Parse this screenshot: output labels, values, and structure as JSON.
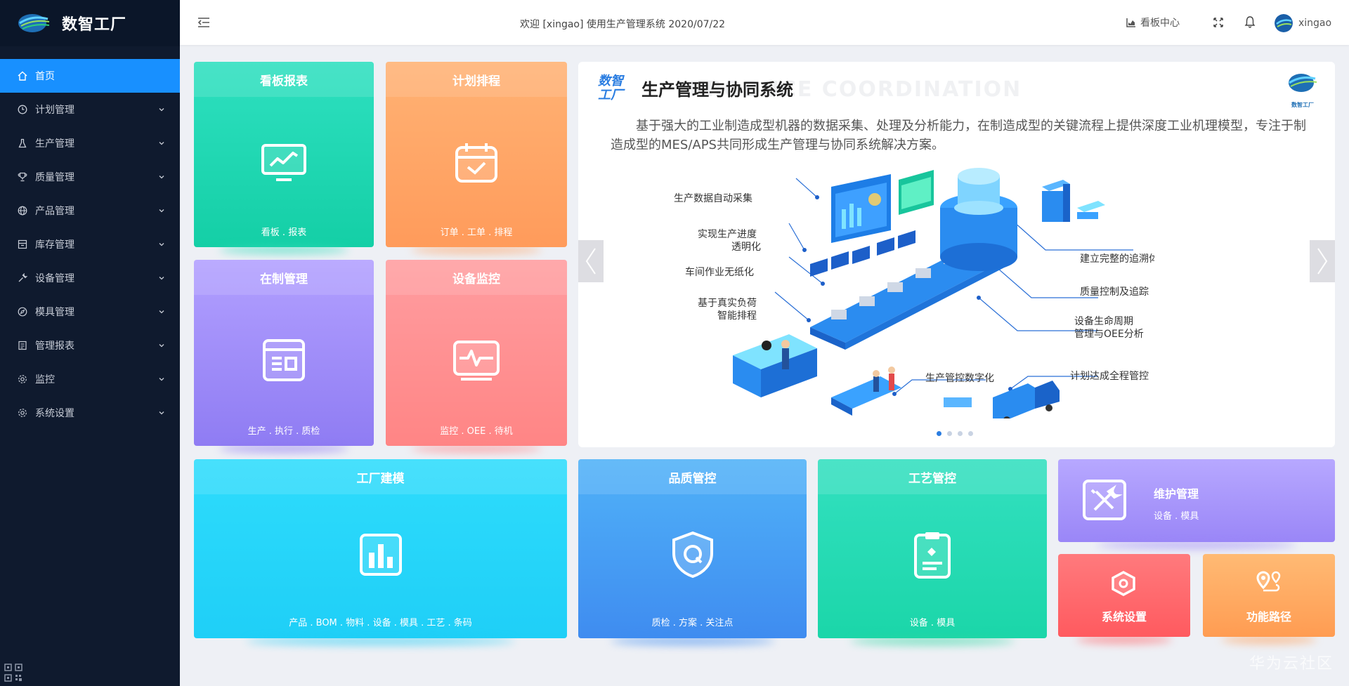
{
  "app": {
    "name": "数智工厂"
  },
  "sidebar": {
    "items": [
      {
        "label": "首页",
        "icon": "home-icon",
        "active": true
      },
      {
        "label": "计划管理",
        "icon": "clock-icon"
      },
      {
        "label": "生产管理",
        "icon": "flask-icon"
      },
      {
        "label": "质量管理",
        "icon": "trophy-icon"
      },
      {
        "label": "产品管理",
        "icon": "globe-icon"
      },
      {
        "label": "库存管理",
        "icon": "warehouse-icon"
      },
      {
        "label": "设备管理",
        "icon": "wrench-icon"
      },
      {
        "label": "模具管理",
        "icon": "compass-icon"
      },
      {
        "label": "管理报表",
        "icon": "report-icon"
      },
      {
        "label": "监控",
        "icon": "gear-icon"
      },
      {
        "label": "系统设置",
        "icon": "gear-icon"
      }
    ]
  },
  "header": {
    "welcome": "欢迎 [xingao] 使用生产管理系统 2020/07/22",
    "kanban_center": "看板中心",
    "username": "xingao"
  },
  "tiles": {
    "kanban": {
      "title": "看板报表",
      "sub": "看板 . 报表"
    },
    "plan": {
      "title": "计划排程",
      "sub": "订单 . 工单 . 排程"
    },
    "wip": {
      "title": "在制管理",
      "sub": "生产 . 执行 . 质检"
    },
    "monitor": {
      "title": "设备监控",
      "sub": "监控 . OEE . 待机"
    },
    "factory": {
      "title": "工厂建模",
      "sub": "产品 . BOM . 物料 . 设备 . 模具 . 工艺 . 条码"
    },
    "quality": {
      "title": "品质管控",
      "sub": "质检 . 方案 . 关注点"
    },
    "process": {
      "title": "工艺管控",
      "sub": "设备 . 模具"
    },
    "maintenance": {
      "title": "维护管理",
      "sub": "设备 . 模具"
    },
    "settings": {
      "title": "系统设置"
    },
    "route": {
      "title": "功能路径"
    }
  },
  "banner": {
    "brand_top": "数智",
    "brand_bottom": "工厂",
    "title": "生产管理与协同系统",
    "title_en": "PRODUCE COORDINATION",
    "logo_text": "数智工厂",
    "description": "基于强大的工业制造成型机器的数据采集、处理及分析能力，在制造成型的关键流程上提供深度工业机理模型，专注于制造成型的MES/APS共同形成生产管理与协同系统解决方案。",
    "labels": {
      "l1": "生产数据自动采集",
      "l2a": "实现生产进度",
      "l2b": "透明化",
      "l3": "车间作业无纸化",
      "l4a": "基于真实负荷",
      "l4b": "智能排程",
      "r1": "建立完整的追溯体系",
      "r2": "质量控制及追踪",
      "r3a": "设备生命周期",
      "r3b": "管理与OEE分析",
      "b1": "生产管控数字化",
      "b2": "计划达成全程管控"
    },
    "slides": 4,
    "active_slide": 0
  },
  "watermark": "华为云社区",
  "colors": {
    "sidebar_bg": "#0f1a2e",
    "active": "#1890ff",
    "page_bg": "#eef0f5"
  }
}
